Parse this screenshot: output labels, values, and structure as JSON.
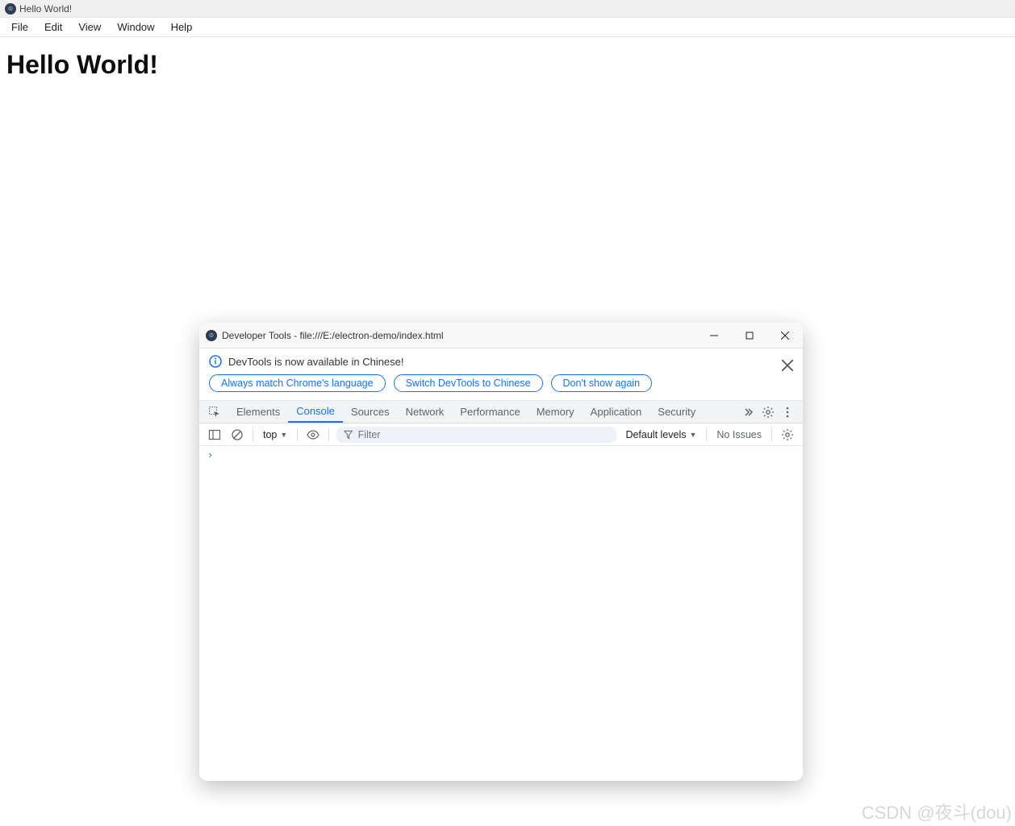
{
  "main_window": {
    "title": "Hello World!",
    "menubar": [
      "File",
      "Edit",
      "View",
      "Window",
      "Help"
    ],
    "heading": "Hello World!"
  },
  "devtools": {
    "title": "Developer Tools - file:///E:/electron-demo/index.html",
    "info": {
      "message": "DevTools is now available in Chinese!",
      "buttons": {
        "match": "Always match Chrome's language",
        "switch": "Switch DevTools to Chinese",
        "dont_show": "Don't show again"
      }
    },
    "tabs": [
      "Elements",
      "Console",
      "Sources",
      "Network",
      "Performance",
      "Memory",
      "Application",
      "Security"
    ],
    "active_tab": "Console",
    "console_toolbar": {
      "context": "top",
      "filter_placeholder": "Filter",
      "levels": "Default levels",
      "issues": "No Issues"
    }
  },
  "watermark": "CSDN @夜斗(dou)"
}
